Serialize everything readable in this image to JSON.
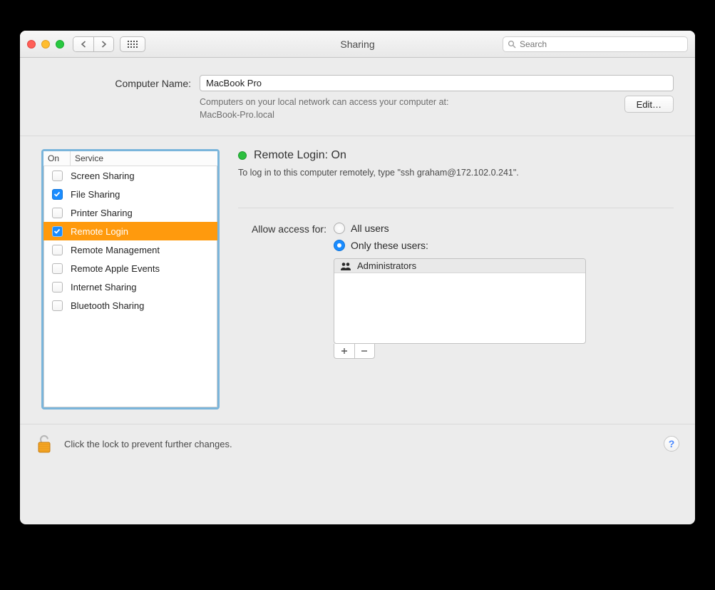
{
  "window": {
    "title": "Sharing",
    "search_placeholder": "Search"
  },
  "computer_name": {
    "label": "Computer Name:",
    "value": "MacBook Pro",
    "helper_line1": "Computers on your local network can access your computer at:",
    "helper_line2": "MacBook-Pro.local",
    "edit_label": "Edit…"
  },
  "services": {
    "header_on": "On",
    "header_service": "Service",
    "items": [
      {
        "label": "Screen Sharing",
        "checked": false,
        "selected": false
      },
      {
        "label": "File Sharing",
        "checked": true,
        "selected": false
      },
      {
        "label": "Printer Sharing",
        "checked": false,
        "selected": false
      },
      {
        "label": "Remote Login",
        "checked": true,
        "selected": true
      },
      {
        "label": "Remote Management",
        "checked": false,
        "selected": false
      },
      {
        "label": "Remote Apple Events",
        "checked": false,
        "selected": false
      },
      {
        "label": "Internet Sharing",
        "checked": false,
        "selected": false
      },
      {
        "label": "Bluetooth Sharing",
        "checked": false,
        "selected": false
      }
    ]
  },
  "detail": {
    "status_title": "Remote Login: On",
    "status_color": "#2cbf3f",
    "instruction": "To log in to this computer remotely, type \"ssh graham@172.102.0.241\".",
    "access_label": "Allow access for:",
    "radio_all": "All users",
    "radio_only": "Only these users:",
    "selected_radio": "only",
    "users": [
      "Administrators"
    ]
  },
  "footer": {
    "text": "Click the lock to prevent further changes."
  }
}
